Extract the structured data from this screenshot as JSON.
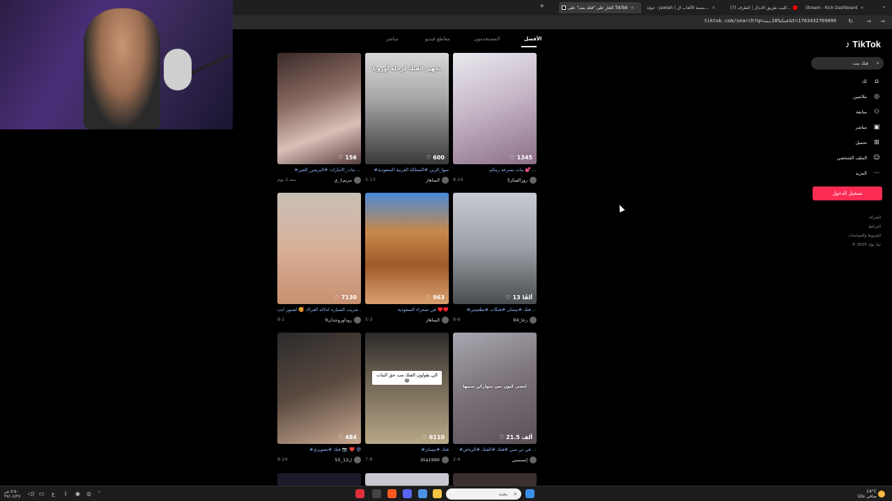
{
  "browser": {
    "tabs": [
      {
        "label": "Stream - Kick Dashboard",
        "color": "#53fc18"
      },
      {
        "label": "(7) كليب طريق الاندال | الطرف...",
        "color": "#ff0000"
      },
      {
        "label": "جولة - Jawlah | منصة الألعاب ال...",
        "color": "#ffffff"
      },
      {
        "label": "الحار على \"فتك بنت\" على TikTok",
        "color": "#000000"
      }
    ],
    "url": "tiktok.com/search?q=فتك%20بنت&t=1763432769099"
  },
  "tiktok": {
    "logo": "TikTok",
    "search_value": "فتك بنت",
    "nav": [
      {
        "label": "لك",
        "icon": "home-icon",
        "glyph": "⌂"
      },
      {
        "label": "ملائمين",
        "icon": "compass-icon",
        "glyph": "◎"
      },
      {
        "label": "متابعة",
        "icon": "follow-icon",
        "glyph": "⚇"
      },
      {
        "label": "مباشر",
        "icon": "live-icon",
        "glyph": "▣"
      },
      {
        "label": "تحميل",
        "icon": "upload-icon",
        "glyph": "⊞"
      },
      {
        "label": "الملف الشخصي",
        "icon": "profile-icon",
        "glyph": "☺"
      },
      {
        "label": "المزيد",
        "icon": "more-icon",
        "glyph": "···"
      }
    ],
    "login_label": "تسجيل الدخول",
    "footer": [
      "الشركة",
      "البرنامج",
      "الشروط والسياسات",
      "© 2025 تيك توك"
    ],
    "tabs": [
      "الأفضل",
      "المستخدمون",
      "مقاطع فيديو",
      "مباشر"
    ],
    "videos": [
      {
        "likes": "1345",
        "caption": "بنات بسرعه ريتكم 💕 ...",
        "user": "روزالفيكر3",
        "date": "8-16"
      },
      {
        "likes": "600",
        "caption": "#سها_الزين #المملكة العربية السعودية",
        "user": "اليماهاز",
        "date": "5-13",
        "overlay": "تجهيز الفتك لرحلة أوروبا"
      },
      {
        "likes": "156",
        "caption": "#بنات_الامارات #البريمي_العين ...",
        "user": "مريم1_ي",
        "date": "منذ 2 يوم"
      },
      {
        "likes": "13 ألفًا",
        "caption": "#فتك #نيسان #فتكات #تطعيس ...",
        "user": "94_زخا",
        "date": "8-6"
      },
      {
        "likes": "963",
        "caption": "في صحراء السعودية ♥️♥️",
        "user": "اليماهاز",
        "date": "5-3"
      },
      {
        "likes": "7130",
        "caption": "شريت السياره لدلاله الفراك 🥰 لصبور انب ...",
        "user": "روداوروجدان9",
        "date": "8-1"
      },
      {
        "likes": "21.5 ألف",
        "caption": "#في تي سي #فتك #الفتك #الرياض ...",
        "user": "إنسميني",
        "date": "2-6",
        "overlay": "انشي كيون بس سواركن سيبها"
      },
      {
        "likes": "6110",
        "caption": "#فتك #نيسان",
        "user": "3lia1990",
        "date": "7-9",
        "label": "الي يقولون الفتك مب حق البنات 😂"
      },
      {
        "likes": "484",
        "caption": "#فتك #تصويري 📷 ❤️ 😅",
        "user": "55_12ل",
        "date": "8-24"
      }
    ]
  },
  "taskbar": {
    "search_placeholder": "بحث",
    "weather": "14°C",
    "weather_desc": "صافي غالبًا",
    "time": "٥:٥٠ ص",
    "date": "٢٧/٠٤/٢٧"
  }
}
